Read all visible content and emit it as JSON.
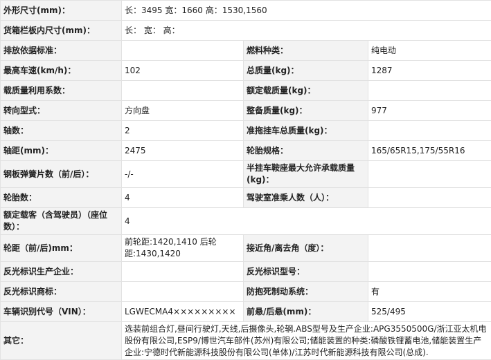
{
  "rows": [
    {
      "l1": "外形尺寸(mm)：",
      "v1": "长：3495 宽：1660 高：1530,1560"
    },
    {
      "l1": "货箱栏板内尺寸(mm)：",
      "v1": "长： 宽： 高："
    },
    {
      "l1": "排放依据标准：",
      "v1": "",
      "l2": "燃料种类：",
      "v2": "纯电动"
    },
    {
      "l1": "最高车速(km/h)：",
      "v1": "102",
      "l2": "总质量(kg)：",
      "v2": "1287"
    },
    {
      "l1": "载质量利用系数：",
      "v1": "",
      "l2": "额定载质量(kg)：",
      "v2": ""
    },
    {
      "l1": "转向型式：",
      "v1": "方向盘",
      "l2": "整备质量(kg)：",
      "v2": "977"
    },
    {
      "l1": "轴数：",
      "v1": "2",
      "l2": "准拖挂车总质量(kg)：",
      "v2": ""
    },
    {
      "l1": "轴距(mm)：",
      "v1": "2475",
      "l2": "轮胎规格：",
      "v2": "165/65R15,175/55R16"
    },
    {
      "l1": "钢板弹簧片数（前/后）：",
      "v1": "-/-",
      "l2": "半挂车鞍座最大允许承载质量(kg)：",
      "v2": ""
    },
    {
      "l1": "轮胎数：",
      "v1": "4",
      "l2": "驾驶室准乘人数（人）：",
      "v2": ""
    },
    {
      "l1": "额定载客（含驾驶员）（座位数）：",
      "v1": "4"
    },
    {
      "l1": "轮距（前/后)mm：",
      "v1": "前轮距:1420,1410 后轮距:1430,1420",
      "l2": "接近角/离去角（度）：",
      "v2": ""
    },
    {
      "l1": "反光标识生产企业：",
      "v1": "",
      "l2": "反光标识型号：",
      "v2": ""
    },
    {
      "l1": "反光标识商标：",
      "v1": "",
      "l2": "防抱死制动系统：",
      "v2": "有"
    },
    {
      "l1": "车辆识别代号（VIN）：",
      "v1": "LGWECMA4×××××××××",
      "l2": "前悬/后悬(mm)：",
      "v2": "525/495"
    },
    {
      "l1": "其它：",
      "v1": "选装前组合灯,昼间行驶灯,天线,后摄像头,轮辋.ABS型号及生产企业:APG3550500G/浙江亚太机电股份有限公司,ESP9/博世汽车部件(苏州)有限公司;储能装置的种类:磷酸铁锂蓄电池,储能装置生产企业:宁德时代新能源科技股份有限公司(单体)/江苏时代新能源科技有限公司(总成)."
    }
  ]
}
